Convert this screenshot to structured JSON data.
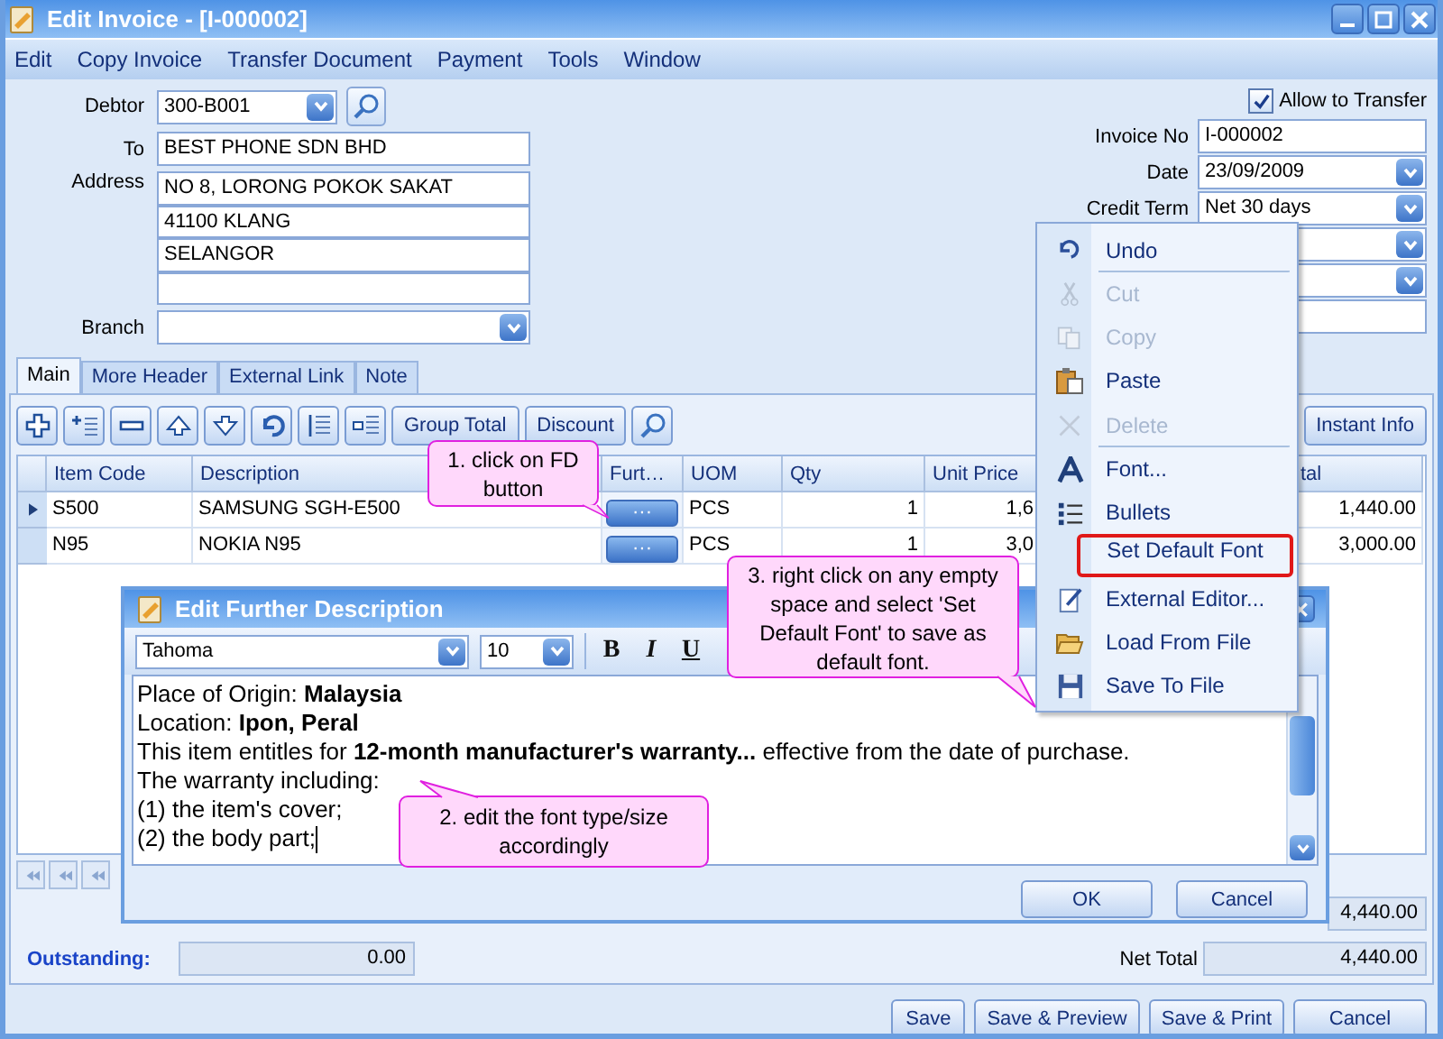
{
  "window": {
    "title": "Edit Invoice - [I-000002]"
  },
  "menu": [
    "Edit",
    "Copy Invoice",
    "Transfer Document",
    "Payment",
    "Tools",
    "Window"
  ],
  "debtor": {
    "label": "Debtor",
    "value": "300-B001"
  },
  "to": {
    "label": "To",
    "value": "BEST PHONE SDN BHD"
  },
  "address": {
    "label": "Address",
    "lines": [
      "NO 8, LORONG POKOK SAKAT",
      "41100 KLANG",
      "SELANGOR"
    ]
  },
  "branch": {
    "label": "Branch"
  },
  "allow_transfer": {
    "label": "Allow to Transfer",
    "checked": true
  },
  "header_fields": [
    {
      "kind": "text",
      "label": "Invoice No",
      "value": "I-000002"
    },
    {
      "kind": "dropdown",
      "label": "Date",
      "value": "23/09/2009"
    },
    {
      "kind": "dropdown",
      "label": "Credit Term",
      "value": "Net 30 days"
    },
    {
      "kind": "dropdown"
    },
    {
      "kind": "dropdown"
    },
    {
      "kind": "text"
    }
  ],
  "tabs": [
    {
      "label": "Main",
      "selected": true
    },
    {
      "label": "More Header",
      "selected": false
    },
    {
      "label": "External Link",
      "selected": false
    },
    {
      "label": "Note",
      "selected": false
    }
  ],
  "toolbar": {
    "buttons": [
      "Group Total",
      "Discount"
    ],
    "instant_info": "Instant Info"
  },
  "table": {
    "columns": [
      "Item Code",
      "Description",
      "Furt…",
      "UOM",
      "Qty",
      "Unit Price",
      "tal"
    ],
    "rows": [
      {
        "current": true,
        "item_code": "S500",
        "description": "SAMSUNG SGH-E500",
        "further": "···",
        "uom": "PCS",
        "qty": "1",
        "unit_price": "1,6",
        "total": "1,440.00"
      },
      {
        "current": false,
        "item_code": "N95",
        "description": "NOKIA N95",
        "further": "···",
        "uom": "PCS",
        "qty": "1",
        "unit_price": "3,0",
        "total": "3,000.00"
      }
    ]
  },
  "totals": {
    "total": "4,440.00",
    "outstanding": {
      "label": "Outstanding:",
      "value": "0.00"
    },
    "net_total": {
      "label": "Net Total",
      "value": "4,440.00"
    }
  },
  "actions": [
    "Save",
    "Save & Preview",
    "Save & Print",
    "Cancel"
  ],
  "dialog": {
    "title": "Edit Further Description",
    "font": "Tahoma",
    "size": "10",
    "format_buttons": [
      "B",
      "I",
      "U"
    ],
    "lines": [
      "Place of Origin: **Malaysia**",
      "Location: **Ipon, Peral**",
      "This item entitles for **12-month manufacturer's warranty...** effective from the date of purchase.",
      "The warranty including:",
      "(1) the item's cover;",
      "(2) the body part;"
    ],
    "buttons": [
      "OK",
      "Cancel"
    ]
  },
  "context_menu": [
    {
      "kind": "undo",
      "label": "Undo",
      "disabled": false,
      "highlighted": false,
      "separator_after": true
    },
    {
      "kind": "cut",
      "label": "Cut",
      "disabled": true,
      "highlighted": false,
      "separator_after": false
    },
    {
      "kind": "copy",
      "label": "Copy",
      "disabled": true,
      "highlighted": false,
      "separator_after": false
    },
    {
      "kind": "paste",
      "label": "Paste",
      "disabled": false,
      "highlighted": false,
      "separator_after": false
    },
    {
      "kind": "delete",
      "label": "Delete",
      "disabled": true,
      "highlighted": false,
      "separator_after": true
    },
    {
      "kind": "font",
      "label": "Font...",
      "disabled": false,
      "highlighted": false,
      "separator_after": false
    },
    {
      "kind": "bullets",
      "label": "Bullets",
      "disabled": false,
      "highlighted": false,
      "separator_after": false
    },
    {
      "kind": "plain",
      "label": "Set Default Font",
      "disabled": false,
      "highlighted": true,
      "separator_after": false
    },
    {
      "kind": "editor",
      "label": "External Editor...",
      "disabled": false,
      "highlighted": false,
      "separator_after": false
    },
    {
      "kind": "open",
      "label": "Load From File",
      "disabled": false,
      "highlighted": false,
      "separator_after": false
    },
    {
      "kind": "save",
      "label": "Save To File",
      "disabled": false,
      "highlighted": false,
      "separator_after": false
    }
  ],
  "callouts": [
    {
      "text": "1. click on FD button"
    },
    {
      "text": "2. edit the font type/size accordingly"
    },
    {
      "text": "3. right click on any empty space and select 'Set Default Font' to save as default font."
    }
  ]
}
